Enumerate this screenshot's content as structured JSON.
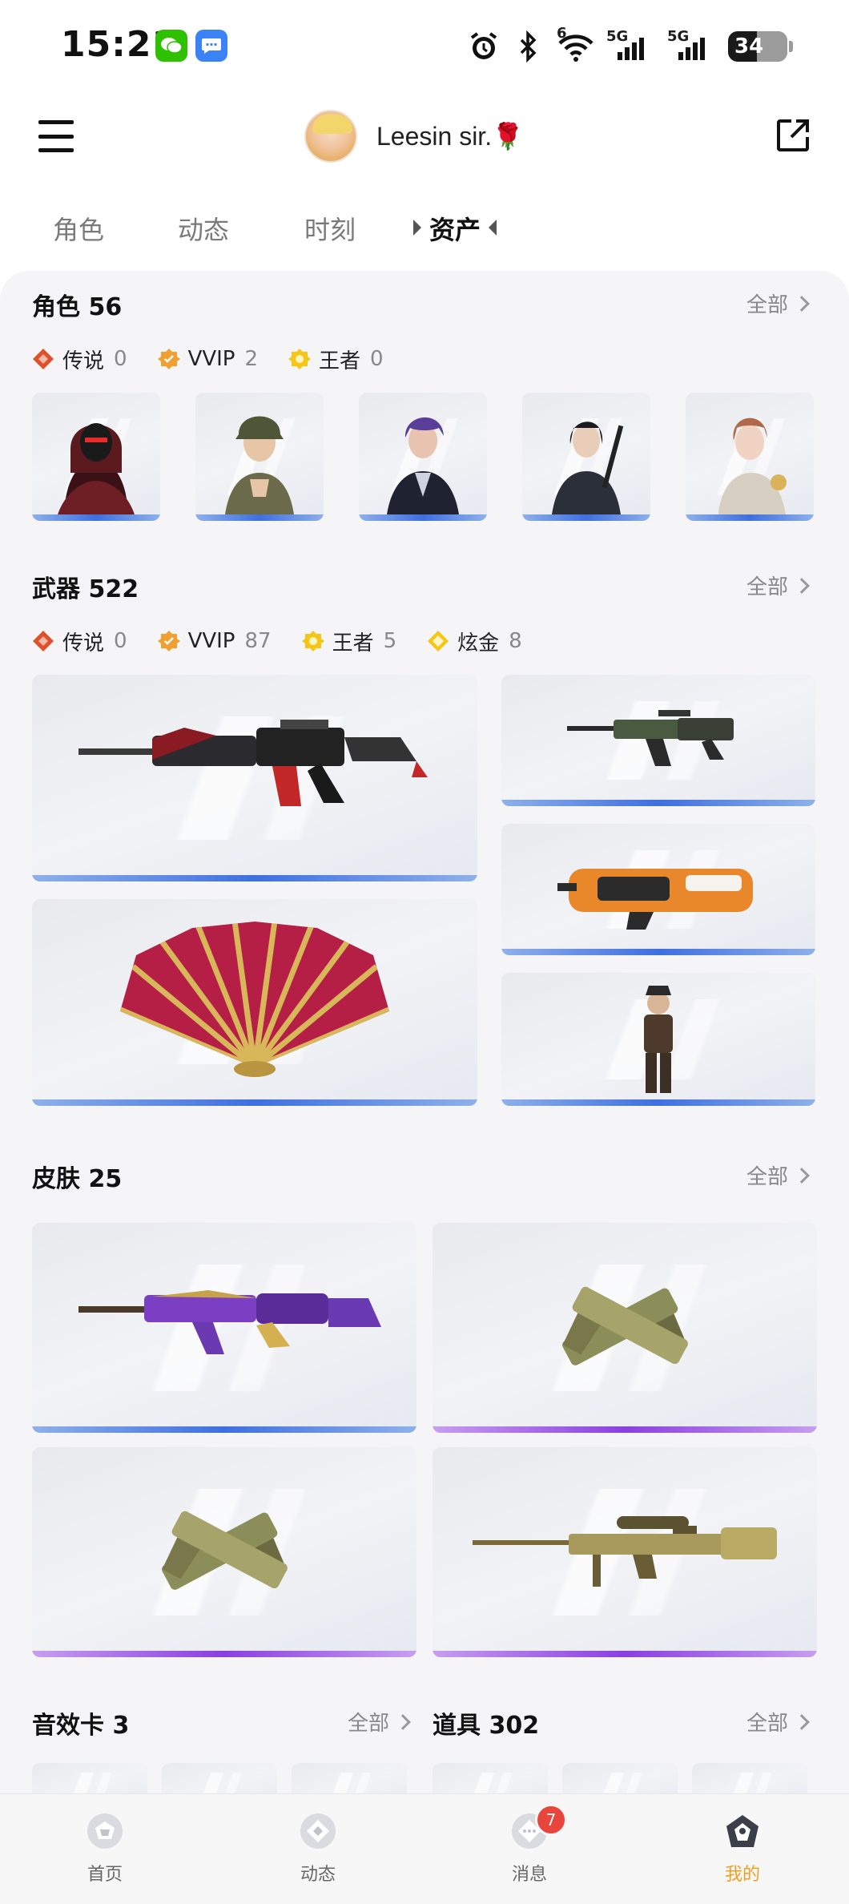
{
  "status_bar": {
    "time": "15:21",
    "network": "5G",
    "network2": "5G",
    "wifi_index": "6",
    "battery": "34"
  },
  "header": {
    "username": "Leesin   sir.🌹"
  },
  "tabs": [
    {
      "label": "角色"
    },
    {
      "label": "动态"
    },
    {
      "label": "时刻"
    },
    {
      "label": "资产"
    }
  ],
  "roles": {
    "title": "角色 56",
    "all_label": "全部",
    "rarities": [
      {
        "label": "传说",
        "count": "0"
      },
      {
        "label": "VVIP",
        "count": "2"
      },
      {
        "label": "王者",
        "count": "0"
      }
    ]
  },
  "weapons": {
    "title": "武器 522",
    "all_label": "全部",
    "rarities": [
      {
        "label": "传说",
        "count": "0"
      },
      {
        "label": "VVIP",
        "count": "87"
      },
      {
        "label": "王者",
        "count": "5"
      },
      {
        "label": "炫金",
        "count": "8"
      }
    ]
  },
  "skins": {
    "title": "皮肤 25",
    "all_label": "全部"
  },
  "sound_cards": {
    "title": "音效卡 3",
    "all_label": "全部"
  },
  "props": {
    "title": "道具 302",
    "all_label": "全部"
  },
  "bottom_nav": [
    {
      "label": "首页"
    },
    {
      "label": "动态"
    },
    {
      "label": "消息",
      "badge": "7"
    },
    {
      "label": "我的"
    }
  ],
  "colors": {
    "accent": "#f0a020",
    "rarity_legend": "#e0502c",
    "rarity_vvip": "#f0a030",
    "rarity_king": "#f5c518",
    "rarity_gold": "#f5c518",
    "rarity_bar_blue": "#3e6fe0",
    "rarity_bar_purple": "#8a3fe0",
    "badge": "#e8453c"
  }
}
